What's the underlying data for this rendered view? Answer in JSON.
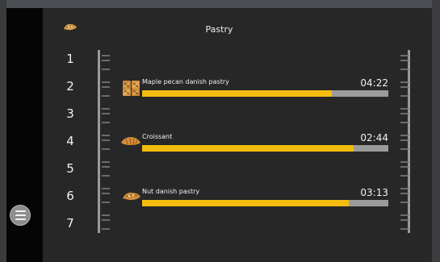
{
  "header": {
    "title": "Pastry",
    "icon": "pastry-icon"
  },
  "rows": [
    "1",
    "2",
    "3",
    "4",
    "5",
    "6",
    "7"
  ],
  "items": [
    {
      "label": "Maple pecan danish pastry",
      "time": "04:22",
      "progress": 0.77,
      "icon": "danish-pastry-icon"
    },
    {
      "label": "Croissant",
      "time": "02:44",
      "progress": 0.86,
      "icon": "croissant-icon"
    },
    {
      "label": "Nut danish pastry",
      "time": "03:13",
      "progress": 0.84,
      "icon": "nut-danish-icon"
    }
  ],
  "menu": {
    "icon": "hamburger-menu-icon"
  },
  "colors": {
    "progress_fill": "#f2bd0f",
    "progress_track": "#9b9b9b",
    "background": "#272727"
  }
}
